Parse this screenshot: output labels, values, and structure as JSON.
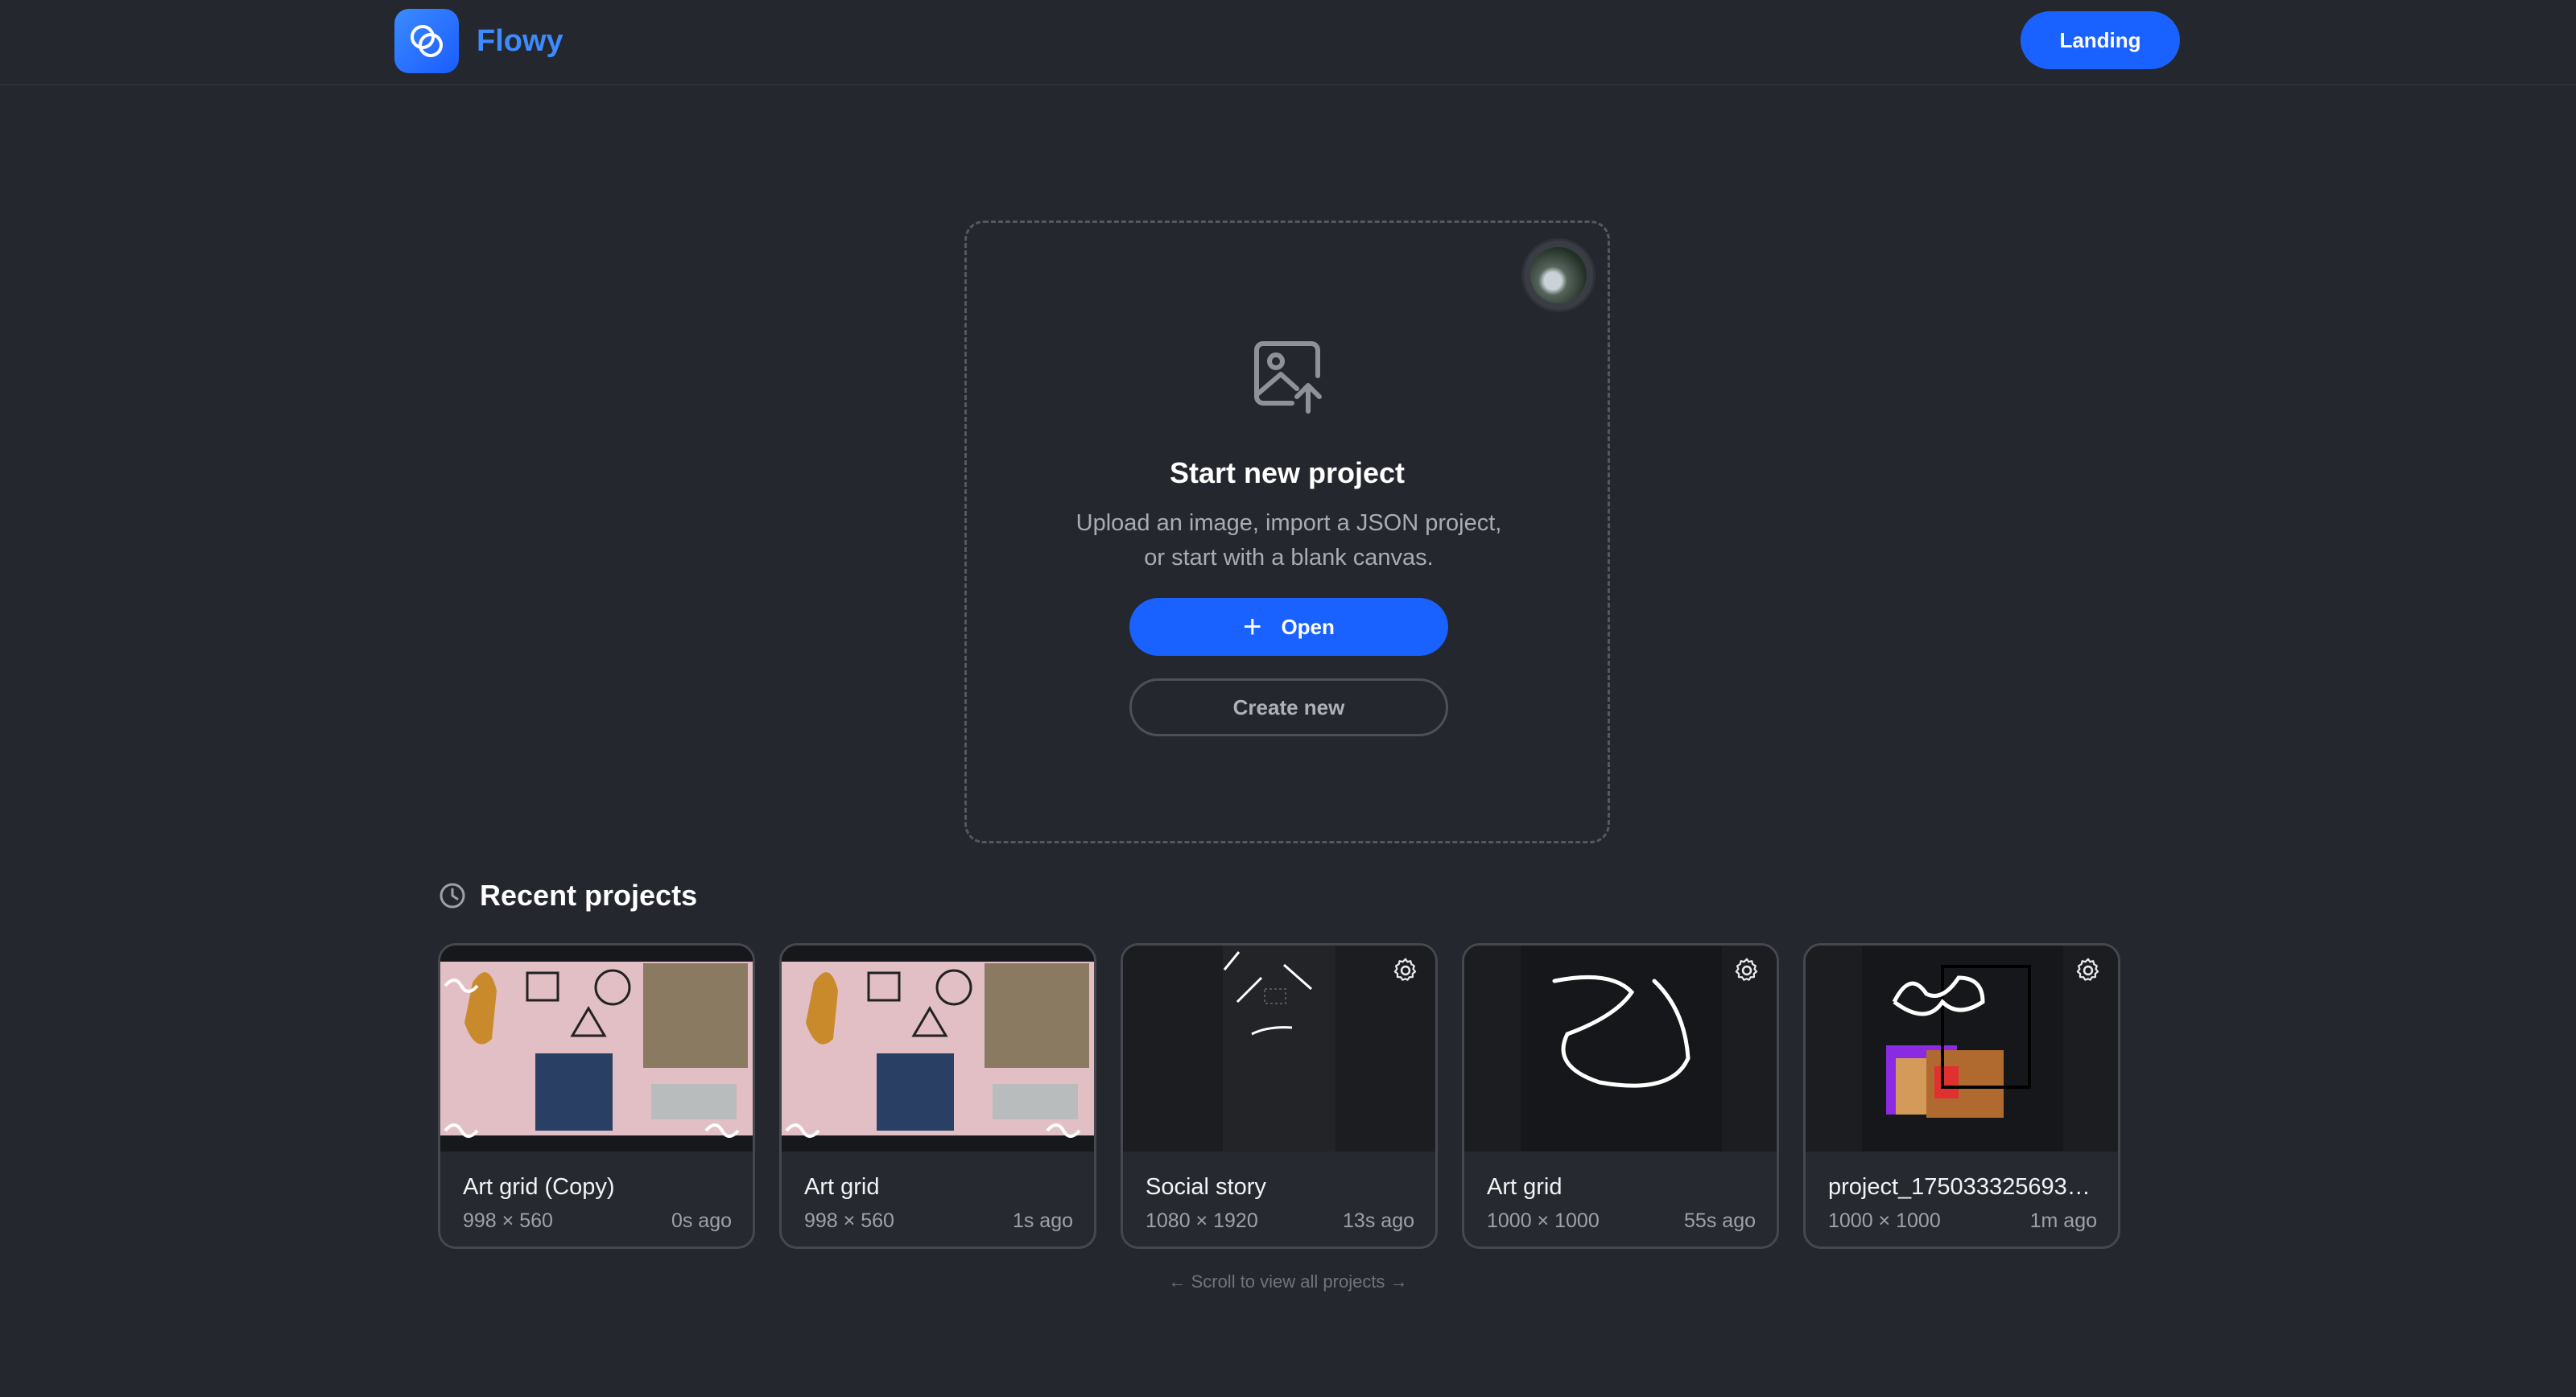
{
  "header": {
    "app_name": "Flowy",
    "logo_icon": "linked-circles-icon",
    "landing_label": "Landing"
  },
  "upload": {
    "title": "Start new project",
    "description_line1": "Upload an image, import a JSON project,",
    "description_line2": "or start with a blank canvas.",
    "open_label": "Open",
    "create_label": "Create new",
    "icon": "image-upload-icon"
  },
  "recent": {
    "title": "Recent projects",
    "icon": "clock-icon",
    "projects": [
      {
        "name": "Art grid (Copy)",
        "size": "998 × 560",
        "time": "0s ago"
      },
      {
        "name": "Art grid",
        "size": "998 × 560",
        "time": "1s ago"
      },
      {
        "name": "Social story",
        "size": "1080 × 1920",
        "time": "13s ago"
      },
      {
        "name": "Art grid",
        "size": "1000 × 1000",
        "time": "55s ago"
      },
      {
        "name": "project_175033325693…",
        "size": "1000 × 1000",
        "time": "1m ago"
      }
    ]
  },
  "scroll_hint": "← Scroll to view all projects →",
  "colors": {
    "background": "#24272d",
    "accent": "#1a62ff",
    "brand": "#3d8bff",
    "card_border": "#45484e",
    "artgrid_bg": "#e2bfc4"
  }
}
